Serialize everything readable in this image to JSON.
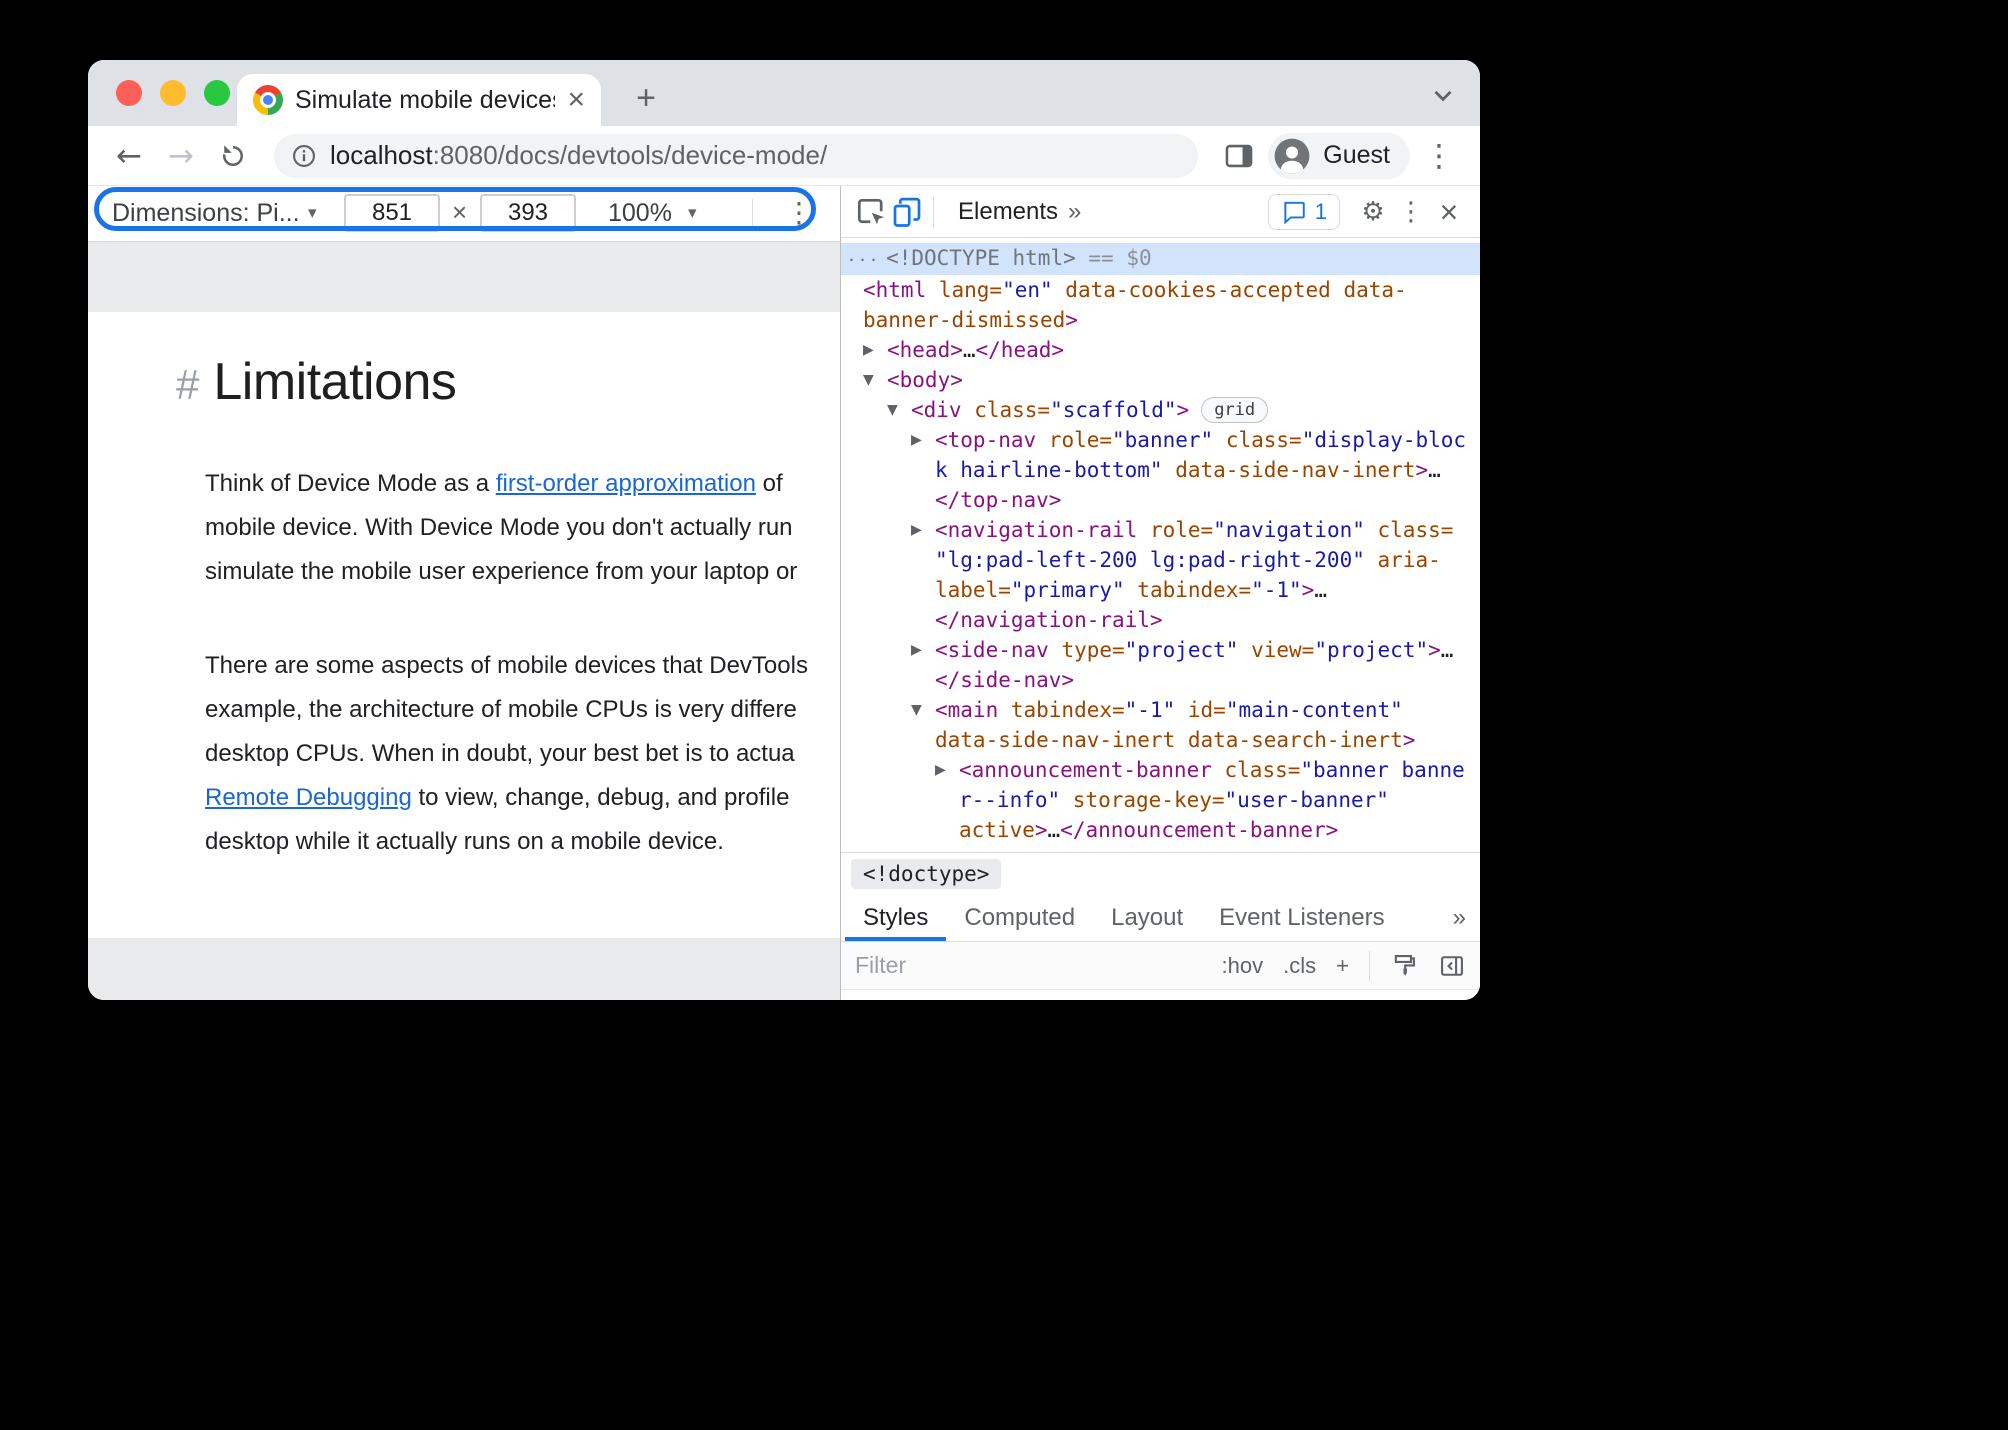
{
  "browser": {
    "tab_title": "Simulate mobile devices with D",
    "tab_close": "×",
    "new_tab": "+",
    "back": "←",
    "forward": "→",
    "url_host": "localhost",
    "url_rest": ":8080/docs/devtools/device-mode/",
    "guest": "Guest"
  },
  "glyphs": {
    "dots_v": "⋮",
    "gear": "⚙",
    "caret": "▾",
    "close": "×"
  },
  "device_toolbar": {
    "dimensions": "Dimensions: Pi...",
    "width": "851",
    "x": "×",
    "height": "393",
    "zoom": "100%"
  },
  "page": {
    "hash": "#",
    "title": "Limitations",
    "para1": [
      [
        {
          "t": "text",
          "s": "Think of Device Mode as a "
        },
        {
          "t": "link",
          "s": "first-order approximation"
        },
        {
          "t": "text",
          "s": " of"
        }
      ],
      [
        {
          "t": "text",
          "s": "mobile device. With Device Mode you don't actually run"
        }
      ],
      [
        {
          "t": "text",
          "s": "simulate the mobile user experience from your laptop or"
        }
      ]
    ],
    "para2": [
      [
        {
          "t": "text",
          "s": "There are some aspects of mobile devices that DevTools"
        }
      ],
      [
        {
          "t": "text",
          "s": "example, the architecture of mobile CPUs is very differe"
        }
      ],
      [
        {
          "t": "text",
          "s": "desktop CPUs. When in doubt, your best bet is to actua"
        }
      ],
      [
        {
          "t": "link",
          "s": "Remote Debugging"
        },
        {
          "t": "text",
          "s": " to view, change, debug, and profile"
        }
      ],
      [
        {
          "t": "text",
          "s": "desktop while it actually runs on a mobile device."
        }
      ]
    ]
  },
  "devtools": {
    "panel_tab": "Elements",
    "more_tabs": "»",
    "issue_count": "1",
    "crumb": "<!doctype>",
    "tabs": [
      "Styles",
      "Computed",
      "Layout",
      "Event Listeners"
    ],
    "tabs_more": "»",
    "filter_placeholder": "Filter",
    "hov": ":hov",
    "cls": ".cls",
    "plus": "+",
    "tree": [
      {
        "level": 0,
        "arrow": "",
        "selected": true,
        "pad": 6,
        "lines": [
          [
            {
              "t": "dots",
              "s": "···"
            },
            {
              "t": "doctype",
              "s": "<!DOCTYPE html>"
            },
            {
              "t": "meta",
              "s": " == $0"
            }
          ]
        ]
      },
      {
        "level": 0,
        "arrow": "",
        "lines": [
          [
            {
              "t": "tag",
              "s": "<html"
            },
            {
              "t": "attr",
              "s": " lang="
            },
            {
              "t": "val",
              "s": "\"en\""
            },
            {
              "t": "attr",
              "s": " data-cookies-accepted data-"
            }
          ],
          [
            {
              "t": "attr",
              "s": "banner-dismissed"
            },
            {
              "t": "tag",
              "s": ">"
            }
          ]
        ]
      },
      {
        "level": 1,
        "arrow": "r",
        "lines": [
          [
            {
              "t": "tag",
              "s": "<head>"
            },
            {
              "t": "plain",
              "s": "…"
            },
            {
              "t": "tag",
              "s": "</head>"
            }
          ]
        ]
      },
      {
        "level": 1,
        "arrow": "d",
        "lines": [
          [
            {
              "t": "tag",
              "s": "<body>"
            }
          ]
        ]
      },
      {
        "level": 2,
        "arrow": "d",
        "lines": [
          [
            {
              "t": "tag",
              "s": "<div"
            },
            {
              "t": "attr",
              "s": " class="
            },
            {
              "t": "val",
              "s": "\"scaffold\""
            },
            {
              "t": "tag",
              "s": ">"
            },
            {
              "t": "badge",
              "s": "grid"
            }
          ]
        ]
      },
      {
        "level": 3,
        "arrow": "r",
        "lines": [
          [
            {
              "t": "tag",
              "s": "<top-nav"
            },
            {
              "t": "attr",
              "s": " role="
            },
            {
              "t": "val",
              "s": "\"banner\""
            },
            {
              "t": "attr",
              "s": " class="
            },
            {
              "t": "val",
              "s": "\"display-bloc"
            }
          ],
          [
            {
              "t": "val",
              "s": "k hairline-bottom\""
            },
            {
              "t": "attr",
              "s": " data-side-nav-inert"
            },
            {
              "t": "tag",
              "s": ">"
            },
            {
              "t": "plain",
              "s": "…"
            }
          ],
          [
            {
              "t": "tag",
              "s": "</top-nav>"
            }
          ]
        ]
      },
      {
        "level": 3,
        "arrow": "r",
        "lines": [
          [
            {
              "t": "tag",
              "s": "<navigation-rail"
            },
            {
              "t": "attr",
              "s": " role="
            },
            {
              "t": "val",
              "s": "\"navigation\""
            },
            {
              "t": "attr",
              "s": " class="
            }
          ],
          [
            {
              "t": "val",
              "s": "\"lg:pad-left-200 lg:pad-right-200\""
            },
            {
              "t": "attr",
              "s": " aria-"
            }
          ],
          [
            {
              "t": "attr",
              "s": "label="
            },
            {
              "t": "val",
              "s": "\"primary\""
            },
            {
              "t": "attr",
              "s": " tabindex="
            },
            {
              "t": "val",
              "s": "\"-1\""
            },
            {
              "t": "tag",
              "s": ">"
            },
            {
              "t": "plain",
              "s": "…"
            }
          ],
          [
            {
              "t": "tag",
              "s": "</navigation-rail>"
            }
          ]
        ]
      },
      {
        "level": 3,
        "arrow": "r",
        "lines": [
          [
            {
              "t": "tag",
              "s": "<side-nav"
            },
            {
              "t": "attr",
              "s": " type="
            },
            {
              "t": "val",
              "s": "\"project\""
            },
            {
              "t": "attr",
              "s": " view="
            },
            {
              "t": "val",
              "s": "\"project\""
            },
            {
              "t": "tag",
              "s": ">"
            },
            {
              "t": "plain",
              "s": "…"
            }
          ],
          [
            {
              "t": "tag",
              "s": "</side-nav>"
            }
          ]
        ]
      },
      {
        "level": 3,
        "arrow": "d",
        "lines": [
          [
            {
              "t": "tag",
              "s": "<main"
            },
            {
              "t": "attr",
              "s": " tabindex="
            },
            {
              "t": "val",
              "s": "\"-1\""
            },
            {
              "t": "attr",
              "s": " id="
            },
            {
              "t": "val",
              "s": "\"main-content\""
            }
          ],
          [
            {
              "t": "attr",
              "s": "data-side-nav-inert data-search-inert"
            },
            {
              "t": "tag",
              "s": ">"
            }
          ]
        ]
      },
      {
        "level": 4,
        "arrow": "r",
        "lines": [
          [
            {
              "t": "tag",
              "s": "<announcement-banner"
            },
            {
              "t": "attr",
              "s": " class="
            },
            {
              "t": "val",
              "s": "\"banner banne"
            }
          ],
          [
            {
              "t": "val",
              "s": "r--info\""
            },
            {
              "t": "attr",
              "s": " storage-key="
            },
            {
              "t": "val",
              "s": "\"user-banner\""
            }
          ],
          [
            {
              "t": "attr",
              "s": "active"
            },
            {
              "t": "tag",
              "s": ">"
            },
            {
              "t": "plain",
              "s": "…"
            },
            {
              "t": "tag",
              "s": "</announcement-banner>"
            }
          ]
        ]
      }
    ]
  },
  "colors": {
    "accent": "#1a73e8",
    "selection": "#d2e3fc"
  }
}
